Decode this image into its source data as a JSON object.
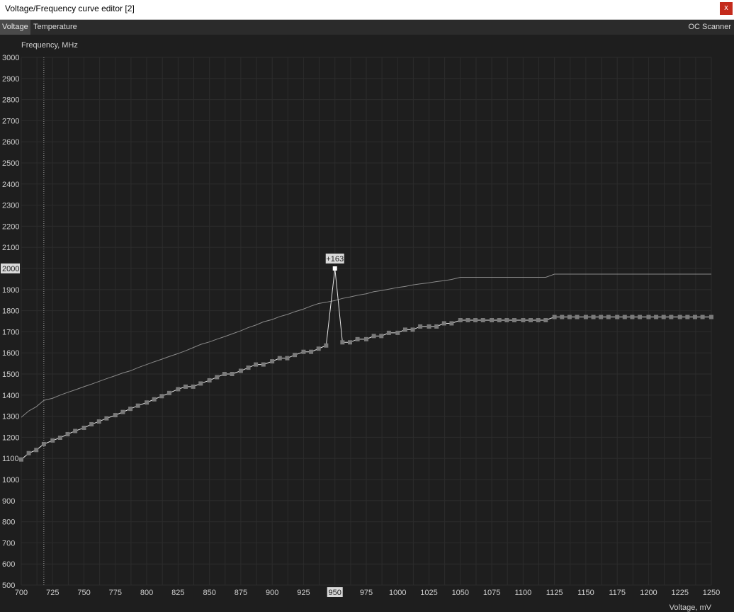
{
  "window": {
    "title": "Voltage/Frequency curve editor [2]",
    "close_label": "x"
  },
  "tabs": [
    {
      "label": "Voltage",
      "active": true
    },
    {
      "label": "Temperature",
      "active": false
    }
  ],
  "oc_scanner_label": "OC Scanner",
  "colors": {
    "background": "#1e1e1e",
    "grid": "#2c2c2c",
    "curve": "#e6e6e6",
    "point": "#7a7a7a",
    "selected_point": "#ffffff",
    "stock_curve": "#8a8a8a",
    "label_highlight_bg": "#d9d9d9",
    "label_highlight_fg": "#1e1e1e"
  },
  "chart_data": {
    "type": "line",
    "ylabel": "Frequency, MHz",
    "xlabel": "Voltage, mV",
    "xlim": [
      700,
      1250
    ],
    "ylim": [
      500,
      3000
    ],
    "x_ticks": [
      700,
      725,
      750,
      775,
      800,
      825,
      850,
      875,
      900,
      925,
      950,
      975,
      1000,
      1025,
      1050,
      1075,
      1100,
      1125,
      1150,
      1175,
      1200,
      1225,
      1250
    ],
    "y_ticks": [
      500,
      600,
      700,
      800,
      900,
      1000,
      1100,
      1200,
      1300,
      1400,
      1500,
      1600,
      1700,
      1800,
      1900,
      2000,
      2100,
      2200,
      2300,
      2400,
      2500,
      2600,
      2700,
      2800,
      2900,
      3000
    ],
    "grid": true,
    "highlighted_x_tick": 950,
    "highlighted_y_tick": 2000,
    "dotted_vertical_line_x": 718,
    "selected_point": {
      "x": 950,
      "y": 2000,
      "label": "+163"
    },
    "series": [
      {
        "role": "stock",
        "style": "thin-line",
        "points": [
          [
            700,
            1295
          ],
          [
            706,
            1325
          ],
          [
            712,
            1345
          ],
          [
            718,
            1375
          ],
          [
            725,
            1385
          ],
          [
            731,
            1400
          ],
          [
            737,
            1413
          ],
          [
            743,
            1425
          ],
          [
            750,
            1440
          ],
          [
            756,
            1452
          ],
          [
            762,
            1465
          ],
          [
            768,
            1478
          ],
          [
            775,
            1492
          ],
          [
            781,
            1505
          ],
          [
            787,
            1515
          ],
          [
            793,
            1530
          ],
          [
            800,
            1545
          ],
          [
            806,
            1558
          ],
          [
            812,
            1570
          ],
          [
            818,
            1583
          ],
          [
            825,
            1597
          ],
          [
            831,
            1610
          ],
          [
            837,
            1625
          ],
          [
            843,
            1640
          ],
          [
            850,
            1652
          ],
          [
            856,
            1665
          ],
          [
            862,
            1677
          ],
          [
            868,
            1690
          ],
          [
            875,
            1705
          ],
          [
            881,
            1720
          ],
          [
            887,
            1732
          ],
          [
            893,
            1747
          ],
          [
            900,
            1758
          ],
          [
            906,
            1772
          ],
          [
            912,
            1782
          ],
          [
            918,
            1795
          ],
          [
            925,
            1808
          ],
          [
            931,
            1822
          ],
          [
            937,
            1834
          ],
          [
            943,
            1840
          ],
          [
            950,
            1848
          ],
          [
            956,
            1858
          ],
          [
            962,
            1865
          ],
          [
            968,
            1873
          ],
          [
            975,
            1880
          ],
          [
            981,
            1890
          ],
          [
            987,
            1895
          ],
          [
            993,
            1902
          ],
          [
            1000,
            1910
          ],
          [
            1006,
            1915
          ],
          [
            1012,
            1922
          ],
          [
            1018,
            1927
          ],
          [
            1025,
            1932
          ],
          [
            1031,
            1938
          ],
          [
            1037,
            1942
          ],
          [
            1043,
            1948
          ],
          [
            1050,
            1958
          ],
          [
            1075,
            1958
          ],
          [
            1100,
            1958
          ],
          [
            1118,
            1958
          ],
          [
            1125,
            1973
          ],
          [
            1150,
            1973
          ],
          [
            1175,
            1973
          ],
          [
            1200,
            1973
          ],
          [
            1225,
            1973
          ],
          [
            1250,
            1973
          ]
        ]
      },
      {
        "role": "curve",
        "style": "line-with-points",
        "points": [
          [
            700,
            1095
          ],
          [
            706,
            1125
          ],
          [
            712,
            1140
          ],
          [
            718,
            1168
          ],
          [
            725,
            1185
          ],
          [
            731,
            1198
          ],
          [
            737,
            1215
          ],
          [
            743,
            1230
          ],
          [
            750,
            1245
          ],
          [
            756,
            1262
          ],
          [
            762,
            1275
          ],
          [
            768,
            1290
          ],
          [
            775,
            1305
          ],
          [
            781,
            1320
          ],
          [
            787,
            1335
          ],
          [
            793,
            1350
          ],
          [
            800,
            1365
          ],
          [
            806,
            1380
          ],
          [
            812,
            1395
          ],
          [
            818,
            1410
          ],
          [
            825,
            1428
          ],
          [
            831,
            1440
          ],
          [
            837,
            1440
          ],
          [
            843,
            1455
          ],
          [
            850,
            1470
          ],
          [
            856,
            1485
          ],
          [
            862,
            1500
          ],
          [
            868,
            1500
          ],
          [
            875,
            1515
          ],
          [
            881,
            1530
          ],
          [
            887,
            1545
          ],
          [
            893,
            1545
          ],
          [
            900,
            1560
          ],
          [
            906,
            1575
          ],
          [
            912,
            1575
          ],
          [
            918,
            1590
          ],
          [
            925,
            1605
          ],
          [
            931,
            1605
          ],
          [
            937,
            1620
          ],
          [
            943,
            1635
          ],
          [
            950,
            2000
          ],
          [
            956,
            1650
          ],
          [
            962,
            1650
          ],
          [
            968,
            1665
          ],
          [
            975,
            1665
          ],
          [
            981,
            1680
          ],
          [
            987,
            1680
          ],
          [
            993,
            1695
          ],
          [
            1000,
            1695
          ],
          [
            1006,
            1710
          ],
          [
            1012,
            1710
          ],
          [
            1018,
            1725
          ],
          [
            1025,
            1725
          ],
          [
            1031,
            1725
          ],
          [
            1037,
            1740
          ],
          [
            1043,
            1740
          ],
          [
            1050,
            1755
          ],
          [
            1056,
            1755
          ],
          [
            1062,
            1755
          ],
          [
            1068,
            1755
          ],
          [
            1075,
            1755
          ],
          [
            1081,
            1755
          ],
          [
            1087,
            1755
          ],
          [
            1093,
            1755
          ],
          [
            1100,
            1755
          ],
          [
            1106,
            1755
          ],
          [
            1112,
            1755
          ],
          [
            1118,
            1755
          ],
          [
            1125,
            1770
          ],
          [
            1131,
            1770
          ],
          [
            1137,
            1770
          ],
          [
            1143,
            1770
          ],
          [
            1150,
            1770
          ],
          [
            1156,
            1770
          ],
          [
            1162,
            1770
          ],
          [
            1168,
            1770
          ],
          [
            1175,
            1770
          ],
          [
            1181,
            1770
          ],
          [
            1187,
            1770
          ],
          [
            1193,
            1770
          ],
          [
            1200,
            1770
          ],
          [
            1206,
            1770
          ],
          [
            1212,
            1770
          ],
          [
            1218,
            1770
          ],
          [
            1225,
            1770
          ],
          [
            1231,
            1770
          ],
          [
            1237,
            1770
          ],
          [
            1243,
            1770
          ],
          [
            1250,
            1770
          ]
        ]
      }
    ]
  }
}
